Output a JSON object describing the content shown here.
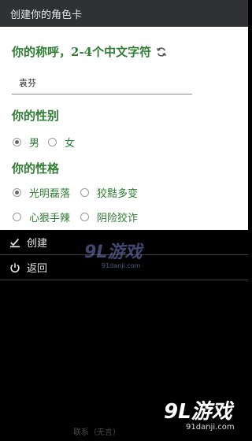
{
  "titlebar": {
    "title": "创建你的角色卡"
  },
  "name_section": {
    "title": "你的称呼，2-4个中文字符",
    "refresh_icon": "refresh-icon",
    "input_value": "袁芬"
  },
  "gender_section": {
    "title": "你的性别",
    "options": [
      {
        "label": "男",
        "checked": true
      },
      {
        "label": "女",
        "checked": false
      }
    ]
  },
  "traits_section": {
    "title": "你的性格",
    "options": [
      {
        "label": "光明磊落",
        "checked": true
      },
      {
        "label": "狡黠多变",
        "checked": false
      },
      {
        "label": "心狠手辣",
        "checked": false
      },
      {
        "label": "阴险狡诈",
        "checked": false
      }
    ]
  },
  "menu": {
    "create_label": "创建",
    "create_icon": "check-edit-icon",
    "back_label": "返回",
    "back_icon": "power-icon"
  },
  "watermark": {
    "brand": "9L游戏",
    "site": "91danji.com"
  },
  "footer": {
    "text": "联系（无言）"
  },
  "colors": {
    "accent_green": "#2e7d32",
    "titlebar_bg": "#2f3133",
    "menu_bg": "#000000"
  }
}
